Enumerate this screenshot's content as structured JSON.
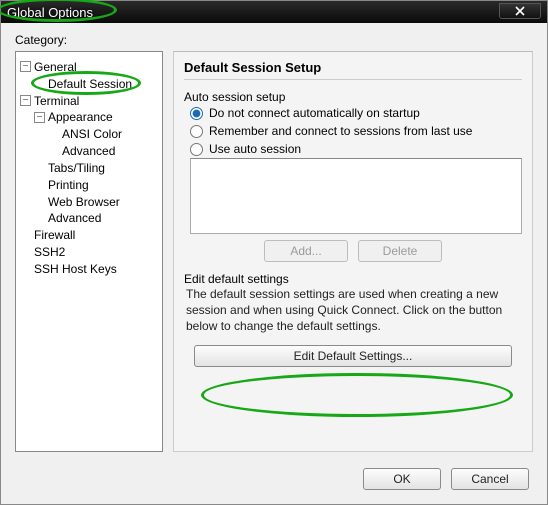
{
  "window": {
    "title": "Global Options"
  },
  "category_label": "Category:",
  "tree": {
    "general": "General",
    "default_session": "Default Session",
    "terminal": "Terminal",
    "appearance": "Appearance",
    "ansi_color": "ANSI Color",
    "advanced_appearance": "Advanced",
    "tabs_tiling": "Tabs/Tiling",
    "printing": "Printing",
    "web_browser": "Web Browser",
    "advanced_terminal": "Advanced",
    "firewall": "Firewall",
    "ssh2": "SSH2",
    "ssh_host_keys": "SSH Host Keys"
  },
  "panel": {
    "title": "Default Session Setup",
    "auto_label": "Auto session setup",
    "radio1": "Do not connect automatically on startup",
    "radio2": "Remember and connect to sessions from last use",
    "radio3": "Use auto session",
    "add_btn": "Add...",
    "delete_btn": "Delete",
    "edit_label": "Edit default settings",
    "edit_desc": "The default session settings are used when creating a new session and when using Quick Connect.  Click on the button below to change the default settings.",
    "edit_btn": "Edit Default Settings..."
  },
  "buttons": {
    "ok": "OK",
    "cancel": "Cancel"
  }
}
